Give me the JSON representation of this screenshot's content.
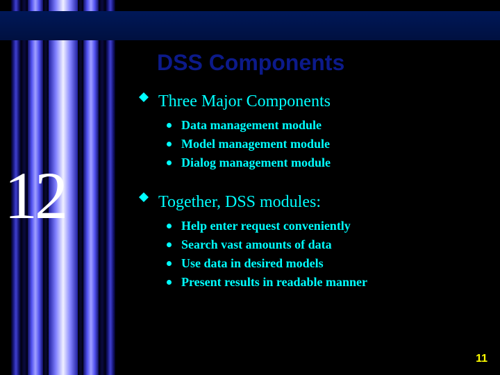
{
  "chapter_number": "12",
  "title": "DSS Components",
  "sections": [
    {
      "heading": "Three Major Components",
      "items": [
        "Data management module",
        "Model management module",
        "Dialog management module"
      ]
    },
    {
      "heading": "Together, DSS modules:",
      "items": [
        "Help enter request conveniently",
        "Search vast amounts of data",
        "Use data in desired models",
        "Present results in readable manner"
      ]
    }
  ],
  "page_number": "11"
}
